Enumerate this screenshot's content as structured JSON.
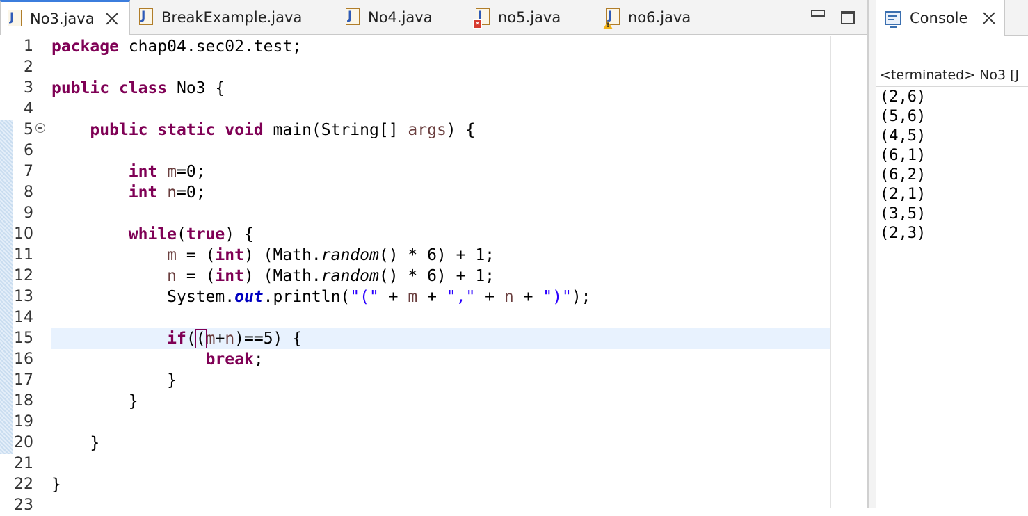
{
  "editor": {
    "tabs": [
      {
        "label": "No3.java",
        "active": true,
        "overlay": "none"
      },
      {
        "label": "BreakExample.java",
        "active": false,
        "overlay": "none"
      },
      {
        "label": "No4.java",
        "active": false,
        "overlay": "none"
      },
      {
        "label": "no5.java",
        "active": false,
        "overlay": "error"
      },
      {
        "label": "no6.java",
        "active": false,
        "overlay": "warning"
      }
    ],
    "current_line": 15,
    "line_numbers": [
      "1",
      "2",
      "3",
      "4",
      "5",
      "6",
      "7",
      "8",
      "9",
      "10",
      "11",
      "12",
      "13",
      "14",
      "15",
      "16",
      "17",
      "18",
      "19",
      "20",
      "21",
      "22",
      "23"
    ],
    "code_lines": [
      "package chap04.sec02.test;",
      "",
      "public class No3 {",
      "",
      "    public static void main(String[] args) {",
      "",
      "        int m=0;",
      "        int n=0;",
      "",
      "        while(true) {",
      "            m = (int) (Math.random() * 6) + 1;",
      "            n = (int) (Math.random() * 6) + 1;",
      "            System.out.println(\"(\" + m + \",\" + n + \")\");",
      "",
      "            if((m+n)==5) {",
      "                break;",
      "            }",
      "        }",
      "",
      "    }",
      "",
      "}",
      ""
    ]
  },
  "console": {
    "tab_label": "Console",
    "status": "<terminated> No3 [J",
    "output": [
      "(2,6)",
      "(5,6)",
      "(4,5)",
      "(6,1)",
      "(6,2)",
      "(2,1)",
      "(3,5)",
      "(2,3)"
    ]
  },
  "icons": {
    "java_file": "java-file-icon",
    "close": "close-icon",
    "minimize": "minimize-icon",
    "maximize": "maximize-icon",
    "console": "console-icon",
    "fold": "fold-collapse-icon"
  },
  "colors": {
    "keyword": "#7f0055",
    "variable": "#6a3e3e",
    "string": "#2a00ff",
    "field": "#0000c0",
    "active_tab_accent": "#3b7ddd",
    "current_line_bg": "#e8f2fe"
  }
}
